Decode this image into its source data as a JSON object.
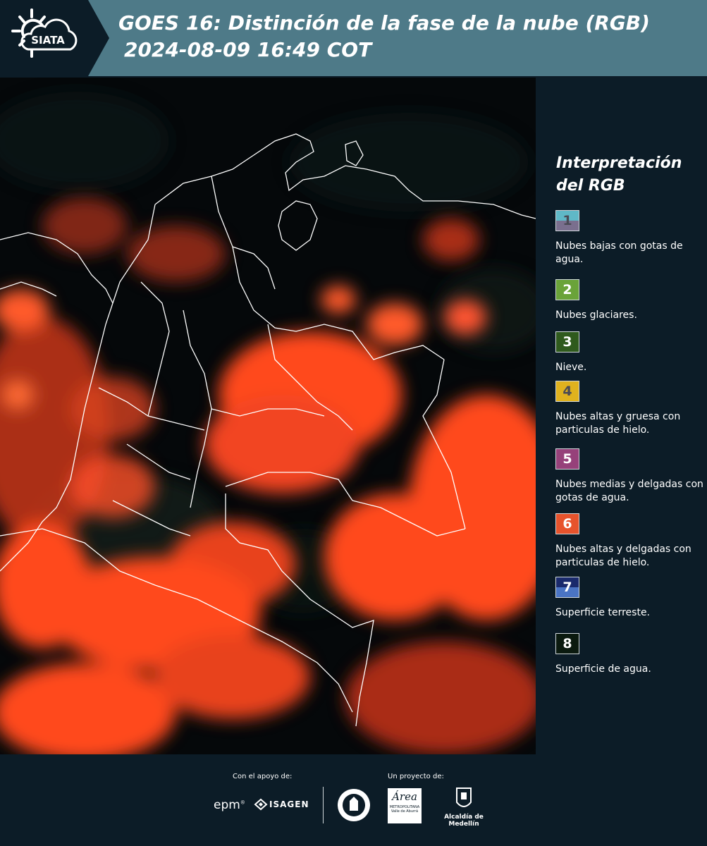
{
  "header": {
    "logo_text": "SIATA",
    "title_line1": "GOES 16: Distinción de la fase de la nube (RGB)",
    "title_line2": "2024-08-09 16:49 COT"
  },
  "legend": {
    "title_line1": "Interpretación",
    "title_line2": "del RGB",
    "items": [
      {
        "number": "1",
        "label": "Nubes bajas con gotas de agua.",
        "color_top": "#5fb8c7",
        "color_bottom": "#7a6f8e",
        "text_color": "#4a4a55"
      },
      {
        "number": "2",
        "label": "Nubes glaciares.",
        "color_top": "#6aa339",
        "color_bottom": "#6aa339",
        "text_color": "#ffffff"
      },
      {
        "number": "3",
        "label": "Nieve.",
        "color_top": "#2f5a1d",
        "color_bottom": "#2f5a1d",
        "text_color": "#ffffff"
      },
      {
        "number": "4",
        "label": "Nubes altas y gruesa con particulas de hielo.",
        "color_top": "#e0b21e",
        "color_bottom": "#e0b21e",
        "text_color": "#4a4a55"
      },
      {
        "number": "5",
        "label": "Nubes medias y delgadas con gotas de agua.",
        "color_top": "#96417a",
        "color_bottom": "#96417a",
        "text_color": "#ffffff"
      },
      {
        "number": "6",
        "label": "Nubes altas y delgadas con particulas de hielo.",
        "color_top": "#e7532c",
        "color_bottom": "#e7532c",
        "text_color": "#ffffff"
      },
      {
        "number": "7",
        "label": "Superficie terreste.",
        "color_top": "#1a2a6c",
        "color_bottom": "#4a74c4",
        "text_color": "#ffffff"
      },
      {
        "number": "8",
        "label": "Superficie de agua.",
        "color_top": "#0b1a0f",
        "color_bottom": "#0b1a0f",
        "text_color": "#ffffff"
      }
    ]
  },
  "footer": {
    "support_label": "Con el apoyo de:",
    "project_label": "Un proyecto de:",
    "sponsor1": "epm",
    "sponsor2": "ISAGEN",
    "partner_area_line1": "Área",
    "partner_area_line2": "METROPOLITANA",
    "partner_area_line3": "Valle de Aburrá",
    "partner_alcaldia": "Alcaldía de Medellín"
  },
  "colors": {
    "header_bg": "#4e7a88",
    "page_bg": "#0c1c27",
    "cloud_orange": "#ff4a1f",
    "boundary": "#ffffff"
  }
}
